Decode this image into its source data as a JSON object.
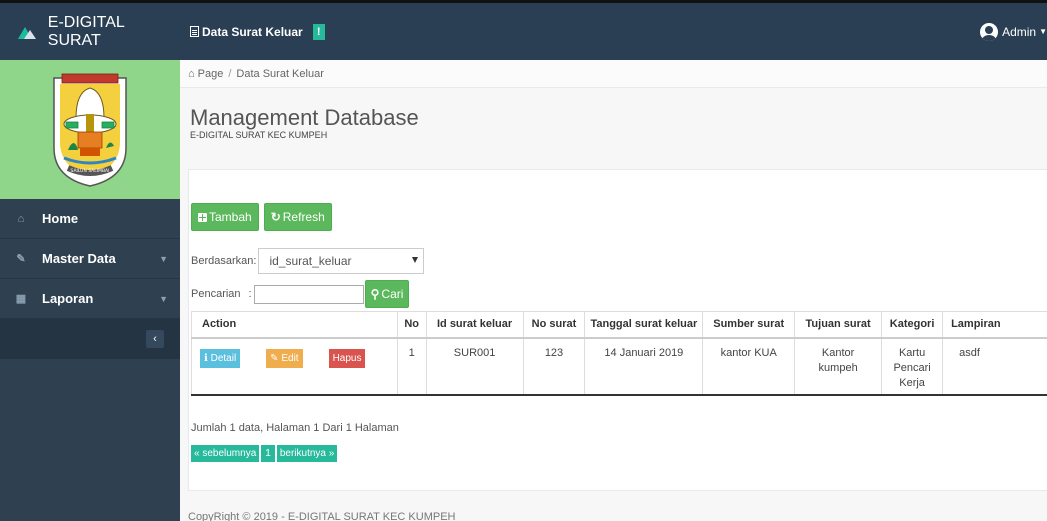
{
  "sidebar": {
    "brand": "E-DIGITAL SURAT",
    "items": [
      {
        "icon": "home-icon",
        "glyph": "⌂",
        "label": "Home"
      },
      {
        "icon": "edit-icon",
        "glyph": "✎",
        "label": "Master Data"
      },
      {
        "icon": "calendar-icon",
        "glyph": "▦",
        "label": "Laporan"
      }
    ],
    "collapse_glyph": "‹"
  },
  "topbar": {
    "title": "Data Surat Keluar",
    "badge": "!",
    "user": "Admin"
  },
  "breadcrumb": {
    "home": "Page",
    "current": "Data Surat Keluar"
  },
  "header": {
    "title": "Management Database",
    "subtitle": "E-DIGITAL SURAT KEC KUMPEH"
  },
  "actions": {
    "tambah": "Tambah",
    "refresh": "Refresh"
  },
  "filter": {
    "label": "Berdasarkan:",
    "selected": "id_surat_keluar"
  },
  "search": {
    "label": "Pencarian",
    "colon": ":",
    "button": "Cari",
    "value": ""
  },
  "table": {
    "headers": [
      "Action",
      "No",
      "Id surat keluar",
      "No surat",
      "Tanggal surat keluar",
      "Sumber surat",
      "Tujuan surat",
      "Kategori",
      "Lampiran"
    ],
    "row_actions": {
      "detail": "Detail",
      "edit": "Edit",
      "hapus": "Hapus"
    },
    "rows": [
      {
        "no": "1",
        "id": "SUR001",
        "no_surat": "123",
        "tanggal": "14 Januari 2019",
        "sumber": "kantor KUA",
        "tujuan": "Kantor kumpeh",
        "kategori": "Kartu Pencari Kerja",
        "lampiran": "asdf"
      }
    ]
  },
  "pagination": {
    "summary": "Jumlah 1 data, Halaman 1 Dari 1 Halaman",
    "prev": "« sebelumnya",
    "page": "1",
    "next": "berikutnya »"
  },
  "footer": {
    "text": "CopyRight © 2019 - E-DIGITAL SURAT KEC KUMPEH"
  },
  "colors": {
    "sidebar": "#2f4050",
    "topbar": "#2a3f54",
    "logo_bg": "#8fd58a",
    "green": "#5cb85c",
    "teal": "#26b99a",
    "info": "#5bc0de",
    "warning": "#f0ad4e",
    "danger": "#d9534f"
  }
}
